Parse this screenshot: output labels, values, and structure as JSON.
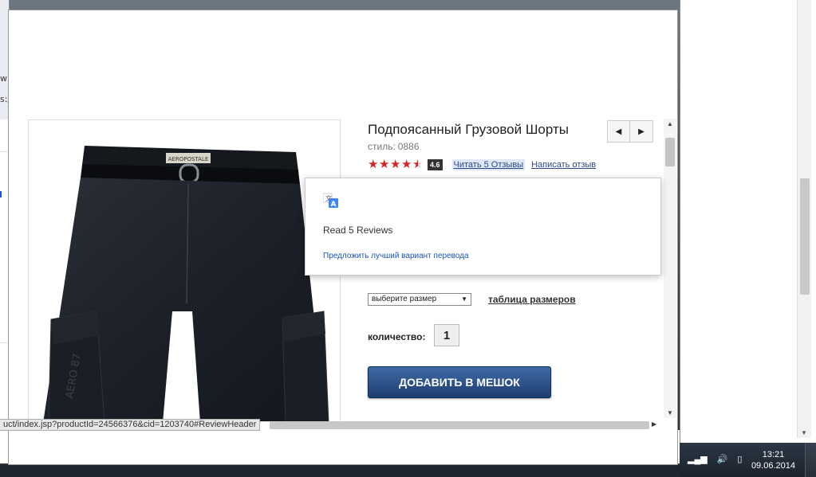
{
  "product": {
    "title": "Подпоясанный Грузовой Шорты",
    "style_label": "стиль:",
    "style_number": "0886",
    "rating": 4.6,
    "rating_badge": "4.6",
    "stars": 5,
    "read_reviews": "Читать 5 Отзывы",
    "write_review": "Написать отзыв"
  },
  "translate_popup": {
    "translated_text": "Read 5 Reviews",
    "suggest_link": "Предложить лучший вариант перевода"
  },
  "size": {
    "selected": "выберите размер",
    "size_chart": "таблица размеров"
  },
  "quantity": {
    "label": "количество:",
    "value": "1"
  },
  "add_button": "ДОБАВИТЬ В МЕШОК",
  "status_url": "uct/index.jsp?productId=24566376&cid=1203740#ReviewHeader",
  "image_brand": "AEROPOSTALE",
  "left_fragments": [
    "w",
    "s:/"
  ],
  "taskbar": {
    "time": "13:21",
    "date": "09.06.2014"
  },
  "colors": {
    "star_red": "#d42525",
    "button_blue": "#2a5088",
    "link_blue": "#2a4a8a"
  }
}
